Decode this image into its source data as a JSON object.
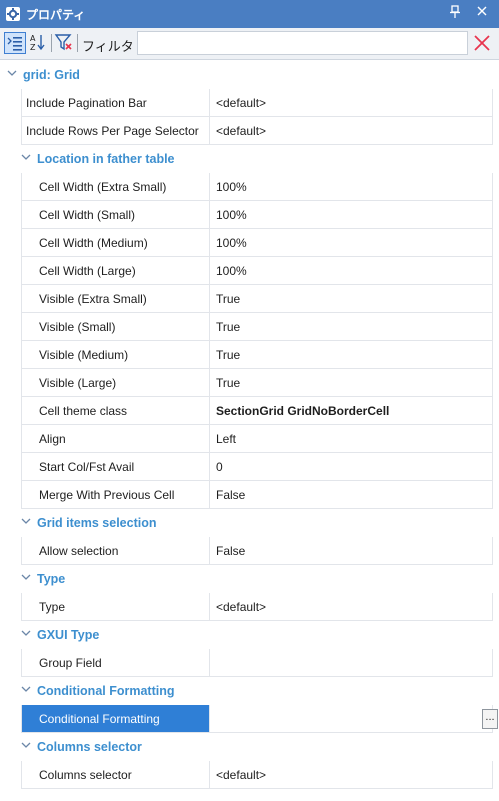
{
  "window": {
    "title": "プロパティ",
    "icon": "gear-icon",
    "pin_glyph": "⫪",
    "close_glyph": "✕"
  },
  "toolbar": {
    "filter_label": "フィルタ",
    "filter_value": "",
    "clear_color": "#e8344e"
  },
  "colors": {
    "title_bar": "#4a7ec2",
    "category_text": "#3d8fcf",
    "selected_bg": "#2f7fd6"
  },
  "root": {
    "label": "grid: Grid"
  },
  "root_props": [
    {
      "name": "Include Pagination Bar",
      "value": "<default>"
    },
    {
      "name": "Include Rows Per Page Selector",
      "value": "<default>"
    }
  ],
  "categories": [
    {
      "label": "Location in father table",
      "props": [
        {
          "name": "Cell Width (Extra Small)",
          "value": "100%"
        },
        {
          "name": "Cell Width (Small)",
          "value": "100%"
        },
        {
          "name": "Cell Width (Medium)",
          "value": "100%"
        },
        {
          "name": "Cell Width (Large)",
          "value": "100%"
        },
        {
          "name": "Visible (Extra Small)",
          "value": "True"
        },
        {
          "name": "Visible (Small)",
          "value": "True"
        },
        {
          "name": "Visible (Medium)",
          "value": "True"
        },
        {
          "name": "Visible (Large)",
          "value": "True"
        },
        {
          "name": "Cell theme class",
          "value": "SectionGrid GridNoBorderCell",
          "bold": true
        },
        {
          "name": "Align",
          "value": "Left"
        },
        {
          "name": "Start Col/Fst Avail",
          "value": "0"
        },
        {
          "name": "Merge With Previous Cell",
          "value": "False"
        }
      ]
    },
    {
      "label": "Grid items selection",
      "props": [
        {
          "name": "Allow selection",
          "value": "False"
        }
      ]
    },
    {
      "label": "Type",
      "props": [
        {
          "name": "Type",
          "value": "<default>"
        }
      ]
    },
    {
      "label": "GXUI Type",
      "props": [
        {
          "name": "Group Field",
          "value": ""
        }
      ]
    },
    {
      "label": "Conditional Formatting",
      "props": [
        {
          "name": "Conditional Formatting",
          "value": "",
          "selected": true,
          "ellipsis": "..."
        }
      ]
    },
    {
      "label": "Columns selector",
      "props": [
        {
          "name": "Columns selector",
          "value": "<default>"
        }
      ]
    }
  ]
}
